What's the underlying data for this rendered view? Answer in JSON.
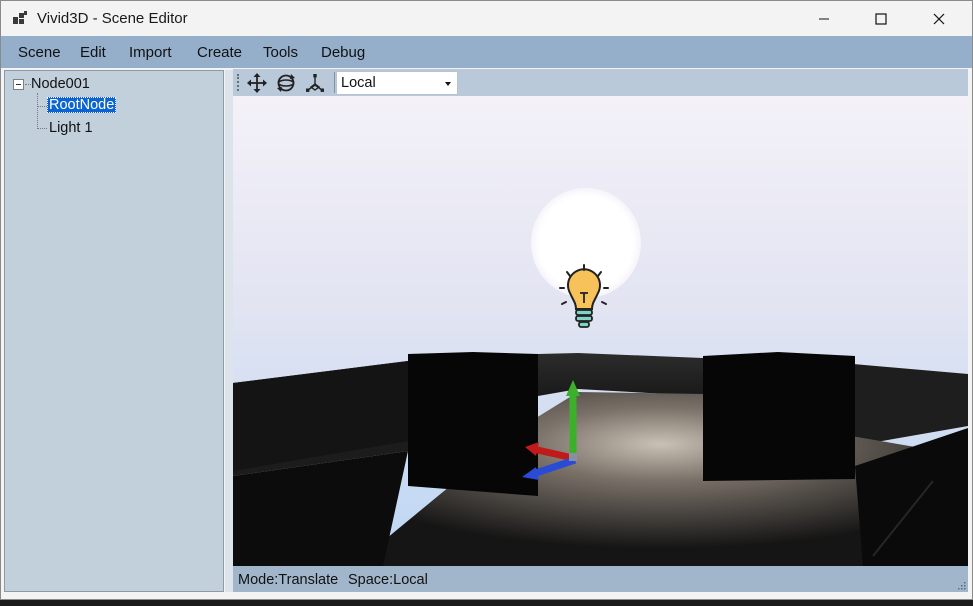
{
  "window": {
    "title": "Vivid3D - Scene Editor",
    "controls": {
      "minimize": "minimize-icon",
      "maximize": "maximize-icon",
      "close": "close-icon"
    }
  },
  "menu": [
    "Scene",
    "Edit",
    "Import",
    "Create",
    "Tools",
    "Debug"
  ],
  "tree": {
    "root": "Node001",
    "children": [
      "RootNode",
      "Light 1"
    ],
    "selected": "RootNode"
  },
  "toolbar": {
    "tools": [
      {
        "name": "translate",
        "icon": "move-arrows-icon"
      },
      {
        "name": "rotate",
        "icon": "rotate-icon"
      },
      {
        "name": "scale",
        "icon": "scale-axes-icon"
      }
    ],
    "space_select": {
      "value": "Local"
    }
  },
  "viewport": {
    "light_icon": "lightbulb-icon",
    "gizmo": {
      "x_color": "#c21a1a",
      "y_color": "#3cb02a",
      "z_color": "#2a4bd6"
    },
    "sky_top": "#f4f1f8",
    "sky_bottom": "#bcd6f3"
  },
  "status": {
    "mode": "Mode:Translate",
    "space": "Space:Local"
  },
  "colors": {
    "menubar": "#95aeca",
    "tree_bg": "#c2d0dc",
    "selection": "#0a64d2",
    "toolbar": "#b9c9d9",
    "statusbar": "#a2b6cb"
  }
}
